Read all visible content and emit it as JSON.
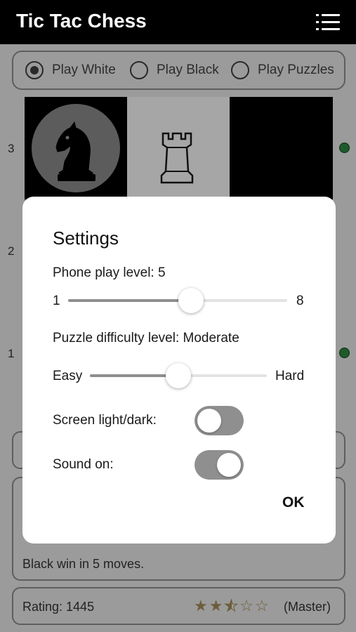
{
  "header": {
    "title": "Tic Tac Chess",
    "menu_icon": "hamburger-list-icon"
  },
  "mode": {
    "options": [
      "Play White",
      "Play Black",
      "Play Puzzles"
    ],
    "selected": "Play White"
  },
  "board": {
    "ranks": [
      "3",
      "2",
      "1"
    ]
  },
  "status": {
    "message": "Black win in 5 moves."
  },
  "rating": {
    "label": "Rating: 1445",
    "stars": 2.5,
    "max_stars": 5,
    "tier": "(Master)"
  },
  "settings": {
    "title": "Settings",
    "phone_level": {
      "label": "Phone play level: 5",
      "min": "1",
      "max": "8",
      "value": 5
    },
    "puzzle": {
      "label": "Puzzle difficulty level: Moderate",
      "min": "Easy",
      "max": "Hard",
      "value": "Moderate"
    },
    "screen": {
      "label": "Screen light/dark:",
      "on": false
    },
    "sound": {
      "label": "Sound on:",
      "on": true
    },
    "ok": "OK"
  }
}
